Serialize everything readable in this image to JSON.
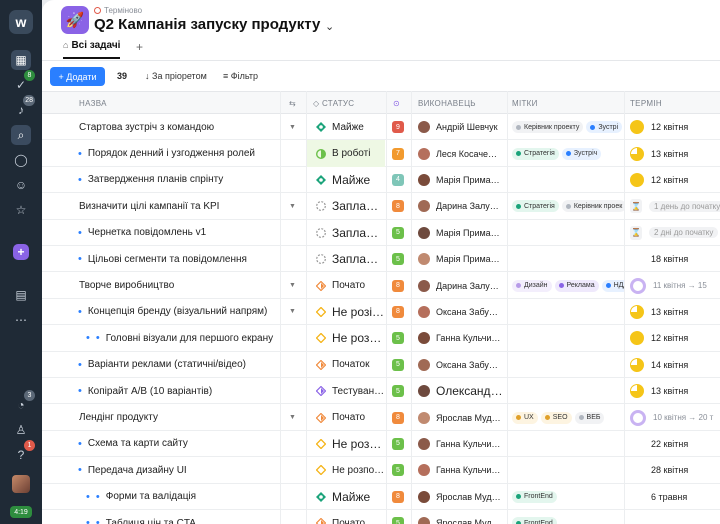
{
  "rail": {
    "logo": "w",
    "badges": {
      "tasks": "8",
      "notifications": "28",
      "timer": "3",
      "help": "1"
    },
    "time": "4:19"
  },
  "header": {
    "urgent_label": "Терміново",
    "title": "Q2 Кампанія запуску продукту",
    "tab": "Всі задачі"
  },
  "toolbar": {
    "add_label": "+ Додати",
    "count": "39",
    "sort_label": "За пріоретом",
    "filter_label": "Фільтр"
  },
  "columns": {
    "name": "НАЗВА",
    "status": "СТАТУС",
    "assignee": "ВИКОНАВЕЦЬ",
    "tags": "МІТКИ",
    "term": "ТЕРМІН"
  },
  "colors": {
    "accent": "#2a7fff",
    "purple": "#8a63e6",
    "rail": "#1f2a36"
  },
  "rows": [
    {
      "name": "Стартова зустріч з командою",
      "sub": false,
      "expand": true,
      "status": "Майже",
      "status_type": "almost",
      "prio": "9",
      "prio_color": "#e05a4a",
      "assignee": "Андрій Шевчук",
      "tags": [
        {
          "t": "Керівник проекту",
          "c": "#b0b6bf",
          "bg": "#f1f2f4"
        },
        {
          "t": "Зустрі",
          "c": "#2a7fff",
          "bg": "#e7f1ff"
        }
      ],
      "term": "12 квітня",
      "term_type": "full"
    },
    {
      "name": "Порядок денний і узгодження ролей",
      "sub": true,
      "expand": false,
      "status": "В роботі",
      "status_type": "work",
      "highlight": true,
      "prio": "7",
      "prio_color": "#f29a2e",
      "assignee": "Леся Косаче…",
      "tags": [
        {
          "t": "Стратегія",
          "c": "#1aa37a",
          "bg": "#e3f6ee"
        },
        {
          "t": "Зустріч",
          "c": "#2a7fff",
          "bg": "#e7f1ff"
        }
      ],
      "term": "13 квітня",
      "term_type": "part"
    },
    {
      "name": "Затвердження планів спрінту",
      "sub": true,
      "expand": false,
      "status": "Майже",
      "status_type": "almost",
      "big": true,
      "prio": "4",
      "prio_color": "#7fc6b8",
      "assignee": "Марія Прима…",
      "tags": [],
      "term": "12 квітня",
      "term_type": "full"
    },
    {
      "name": "Визначити цілі кампанії та KPI",
      "sub": false,
      "expand": true,
      "status": "Запла…",
      "status_type": "plan",
      "big": true,
      "prio": "8",
      "prio_color": "#f08a3c",
      "assignee": "Дарина Залу…",
      "tags": [
        {
          "t": "Стратегія",
          "c": "#1aa37a",
          "bg": "#e3f6ee"
        },
        {
          "t": "Керівник проек",
          "c": "#b0b6bf",
          "bg": "#f1f2f4"
        }
      ],
      "term": "1 день до початку",
      "term_type": "hour"
    },
    {
      "name": "Чернетка повідомлень v1",
      "sub": true,
      "expand": false,
      "status": "Запла…",
      "status_type": "plan",
      "big": true,
      "prio": "5",
      "prio_color": "#6cc04a",
      "assignee": "Марія Прима…",
      "tags": [],
      "term": "2 дні до початку",
      "term_type": "hour"
    },
    {
      "name": "Цільові сегменти та повідомлення",
      "sub": true,
      "expand": false,
      "status": "Запла…",
      "status_type": "plan",
      "big": true,
      "prio": "5",
      "prio_color": "#6cc04a",
      "assignee": "Марія Прима…",
      "tags": [],
      "term": "18 квітня",
      "term_type": "none"
    },
    {
      "name": "Творче виробництво",
      "sub": false,
      "expand": true,
      "status": "Почато",
      "status_type": "start",
      "prio": "8",
      "prio_color": "#f08a3c",
      "assignee": "Дарина Залу…",
      "tags": [
        {
          "t": "Дизайн",
          "c": "#b79be8",
          "bg": "#f3eefc"
        },
        {
          "t": "Реклама",
          "c": "#8a63e6",
          "bg": "#efe9fc"
        },
        {
          "t": "НДД",
          "c": "#2a7fff",
          "bg": "#e7f1ff"
        }
      ],
      "term": "11 квітня → 15",
      "term_type": "ring"
    },
    {
      "name": "Концепція бренду (візуальний напрям)",
      "sub": true,
      "expand": true,
      "status": "Не розі…",
      "status_type": "not",
      "big": true,
      "prio": "8",
      "prio_color": "#f08a3c",
      "assignee": "Оксана Забу…",
      "tags": [],
      "term": "13 квітня",
      "term_type": "part"
    },
    {
      "name": "Головні візуали для першого екрану",
      "sub": true,
      "deep": true,
      "expand": false,
      "status": "Не роз…",
      "status_type": "not",
      "big": true,
      "prio": "5",
      "prio_color": "#6cc04a",
      "assignee": "Ганна Кульчи…",
      "tags": [],
      "term": "12 квітня",
      "term_type": "full"
    },
    {
      "name": "Варіанти реклами (статичні/відео)",
      "sub": true,
      "expand": false,
      "status": "Початок",
      "status_type": "start",
      "prio": "5",
      "prio_color": "#6cc04a",
      "assignee": "Оксана Забу…",
      "tags": [],
      "term": "14 квітня",
      "term_type": "part"
    },
    {
      "name": "Копірайт A/B (10 варіантів)",
      "sub": true,
      "expand": false,
      "status": "Тестуван…",
      "status_type": "test",
      "prio": "5",
      "prio_color": "#6cc04a",
      "assignee": "Олександ…",
      "assignee_big": true,
      "tags": [],
      "term": "13 квітня",
      "term_type": "part"
    },
    {
      "name": "Лендінг продукту",
      "sub": false,
      "expand": true,
      "status": "Почато",
      "status_type": "start",
      "prio": "8",
      "prio_color": "#f08a3c",
      "assignee": "Ярослав Муд…",
      "tags": [
        {
          "t": "UX",
          "c": "#e0a02a",
          "bg": "#fdf4e1"
        },
        {
          "t": "SEO",
          "c": "#e0a02a",
          "bg": "#fdf4e1"
        },
        {
          "t": "ВЕБ",
          "c": "#b0b6bf",
          "bg": "#f1f2f4"
        }
      ],
      "term": "10 квітня → 20 т",
      "term_type": "ring"
    },
    {
      "name": "Схема та карти сайту",
      "sub": true,
      "expand": false,
      "status": "Не роз…",
      "status_type": "not",
      "big": true,
      "prio": "5",
      "prio_color": "#6cc04a",
      "assignee": "Ганна Кульчи…",
      "tags": [],
      "term": "22 квітня",
      "term_type": "none"
    },
    {
      "name": "Передача дизайну UI",
      "sub": true,
      "expand": false,
      "status": "Не розпо…",
      "status_type": "not",
      "prio": "5",
      "prio_color": "#6cc04a",
      "assignee": "Ганна Кульчи…",
      "tags": [],
      "term": "28 квітня",
      "term_type": "none"
    },
    {
      "name": "Форми та валідація",
      "sub": true,
      "deep": true,
      "expand": false,
      "status": "Майже",
      "status_type": "almost",
      "big": true,
      "prio": "8",
      "prio_color": "#f08a3c",
      "assignee": "Ярослав Муд…",
      "tags": [
        {
          "t": "FrontEnd",
          "c": "#1aa37a",
          "bg": "#e3f6ee"
        }
      ],
      "term": "6 травня",
      "term_type": "none"
    },
    {
      "name": "Таблиця цін та CTA",
      "sub": true,
      "deep": true,
      "expand": false,
      "status": "Почато",
      "status_type": "start",
      "prio": "5",
      "prio_color": "#6cc04a",
      "assignee": "Ярослав Муд…",
      "tags": [
        {
          "t": "FrontEnd",
          "c": "#1aa37a",
          "bg": "#e3f6ee"
        }
      ],
      "term": "",
      "term_type": "none"
    }
  ]
}
